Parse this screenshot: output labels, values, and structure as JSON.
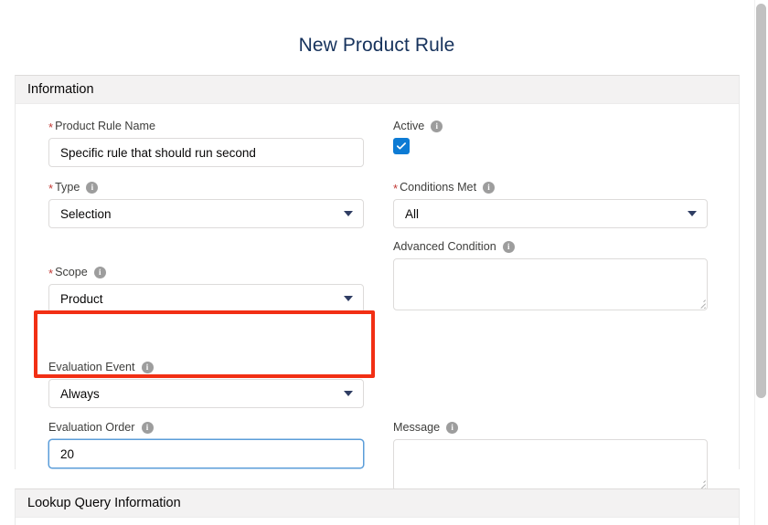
{
  "header": {
    "title": "New Product Rule"
  },
  "sections": {
    "information": {
      "title": "Information"
    },
    "lookup": {
      "title": "Lookup Query Information"
    }
  },
  "fields": {
    "product_rule_name": {
      "label": "Product Rule Name",
      "required": true,
      "value": "Specific rule that should run second",
      "placeholder": ""
    },
    "type": {
      "label": "Type",
      "required": true,
      "value": "Selection",
      "options": [
        "Selection"
      ]
    },
    "scope": {
      "label": "Scope",
      "required": true,
      "value": "Product",
      "options": [
        "Product"
      ]
    },
    "evaluation_event": {
      "label": "Evaluation Event",
      "required": false,
      "value": "Always",
      "options": [
        "Always"
      ]
    },
    "evaluation_order": {
      "label": "Evaluation Order",
      "required": false,
      "value": "20",
      "placeholder": ""
    },
    "active": {
      "label": "Active",
      "required": false,
      "checked": true
    },
    "conditions_met": {
      "label": "Conditions Met",
      "required": true,
      "value": "All",
      "options": [
        "All"
      ]
    },
    "advanced_condition": {
      "label": "Advanced Condition",
      "required": false,
      "value": "",
      "placeholder": ""
    },
    "message": {
      "label": "Message",
      "required": false,
      "value": "",
      "placeholder": ""
    }
  },
  "icons": {
    "info": "info-icon",
    "checkmark": "check-icon",
    "dropdown": "chevron-down-icon"
  },
  "colors": {
    "required_marker": "#c23934",
    "checkbox_blue": "#0d7bd4",
    "highlight_red": "#f22f14",
    "focus_blue": "#5b9dd9",
    "section_header_bg": "#f3f2f2",
    "title_text": "#16325c"
  }
}
